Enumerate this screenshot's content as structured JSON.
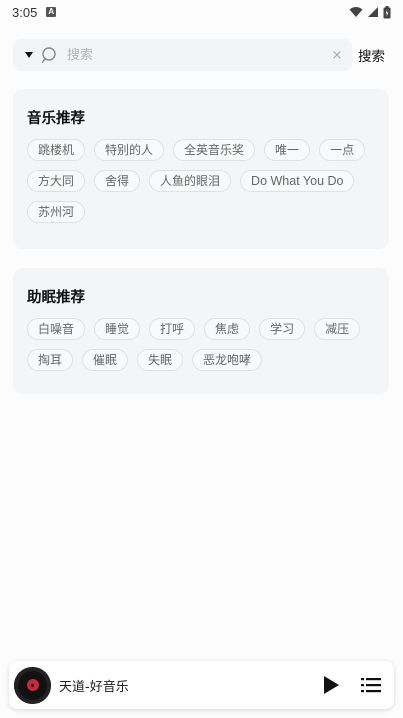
{
  "status_bar": {
    "time": "3:05",
    "notification_icon": "A"
  },
  "search": {
    "placeholder": "搜索",
    "value": "",
    "clear_glyph": "×",
    "button_label": "搜索"
  },
  "music_card": {
    "title": "音乐推荐",
    "tags": [
      "跳楼机",
      "特别的人",
      "全英音乐奖",
      "唯一",
      "一点",
      "方大同",
      "舍得",
      "人鱼的眼泪",
      "Do What You Do",
      "苏州河"
    ]
  },
  "sleep_card": {
    "title": "助眠推荐",
    "tags": [
      "白噪音",
      "睡觉",
      "打呼",
      "焦虑",
      "学习",
      "减压",
      "掏耳",
      "催眠",
      "失眠",
      "恶龙咆哮"
    ]
  },
  "player": {
    "title": "天道-好音乐"
  },
  "colors": {
    "background": "#fcfcfd",
    "card": "#f4f5f7",
    "vinyl_label": "#c72a3a"
  }
}
